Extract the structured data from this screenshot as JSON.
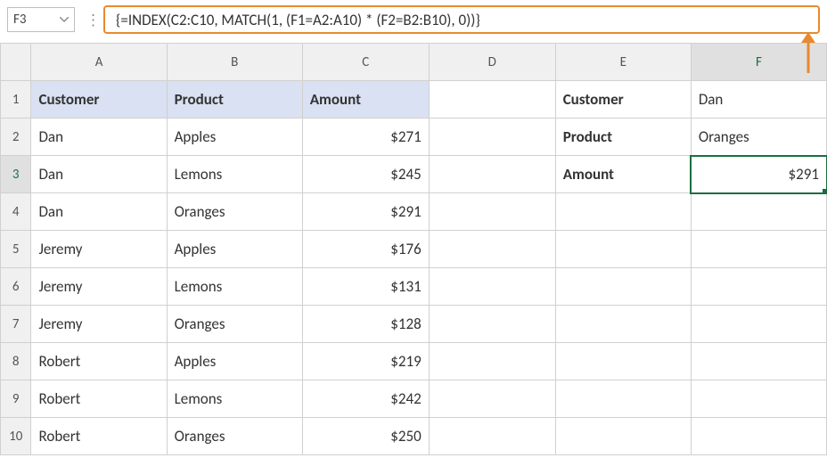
{
  "nameBox": "F3",
  "formula": "{=INDEX(C2:C10, MATCH(1, (F1=A2:A10) * (F2=B2:B10), 0))}",
  "columns": [
    "A",
    "B",
    "C",
    "D",
    "E",
    "F"
  ],
  "selectedCol": "F",
  "selectedRow": 3,
  "rows": [
    {
      "n": 1,
      "A": "Customer",
      "B": "Product",
      "C": "Amount",
      "D": "",
      "E": "Customer",
      "F": "Dan",
      "hdr": [
        "A",
        "B",
        "C"
      ],
      "bold": [
        "E"
      ]
    },
    {
      "n": 2,
      "A": "Dan",
      "B": "Apples",
      "C": "$271",
      "D": "",
      "E": "Product",
      "F": "Oranges",
      "bold": [
        "E"
      ],
      "num": [
        "C"
      ]
    },
    {
      "n": 3,
      "A": "Dan",
      "B": "Lemons",
      "C": "$245",
      "D": "",
      "E": "Amount",
      "F": "$291",
      "bold": [
        "E"
      ],
      "num": [
        "C",
        "F"
      ],
      "active": "F"
    },
    {
      "n": 4,
      "A": "Dan",
      "B": "Oranges",
      "C": "$291",
      "D": "",
      "E": "",
      "F": "",
      "num": [
        "C"
      ]
    },
    {
      "n": 5,
      "A": "Jeremy",
      "B": "Apples",
      "C": "$176",
      "D": "",
      "E": "",
      "F": "",
      "num": [
        "C"
      ]
    },
    {
      "n": 6,
      "A": "Jeremy",
      "B": "Lemons",
      "C": "$131",
      "D": "",
      "E": "",
      "F": "",
      "num": [
        "C"
      ]
    },
    {
      "n": 7,
      "A": "Jeremy",
      "B": "Oranges",
      "C": "$128",
      "D": "",
      "E": "",
      "F": "",
      "num": [
        "C"
      ]
    },
    {
      "n": 8,
      "A": "Robert",
      "B": "Apples",
      "C": "$219",
      "D": "",
      "E": "",
      "F": "",
      "num": [
        "C"
      ]
    },
    {
      "n": 9,
      "A": "Robert",
      "B": "Lemons",
      "C": "$242",
      "D": "",
      "E": "",
      "F": "",
      "num": [
        "C"
      ]
    },
    {
      "n": 10,
      "A": "Robert",
      "B": "Oranges",
      "C": "$250",
      "D": "",
      "E": "",
      "F": "",
      "num": [
        "C"
      ]
    }
  ],
  "chart_data": {
    "type": "table",
    "main_table_headers": [
      "Customer",
      "Product",
      "Amount"
    ],
    "main_table_rows": [
      [
        "Dan",
        "Apples",
        271
      ],
      [
        "Dan",
        "Lemons",
        245
      ],
      [
        "Dan",
        "Oranges",
        291
      ],
      [
        "Jeremy",
        "Apples",
        176
      ],
      [
        "Jeremy",
        "Lemons",
        131
      ],
      [
        "Jeremy",
        "Oranges",
        128
      ],
      [
        "Robert",
        "Apples",
        219
      ],
      [
        "Robert",
        "Lemons",
        242
      ],
      [
        "Robert",
        "Oranges",
        250
      ]
    ],
    "lookup": {
      "Customer": "Dan",
      "Product": "Oranges",
      "Amount": 291
    }
  }
}
